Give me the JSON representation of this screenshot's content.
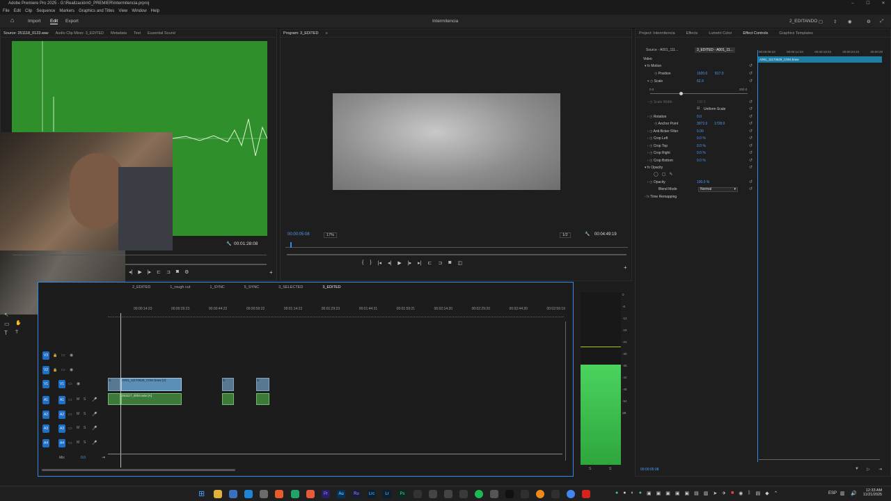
{
  "titlebar": {
    "title": "Adobe Premiere Pro 2025 - G:\\Realización\\0_PREMIER\\Intermitencia.prproj",
    "minimize": "–",
    "maximize": "☐",
    "close": "✕"
  },
  "menu": [
    "File",
    "Edit",
    "Clip",
    "Sequence",
    "Markers",
    "Graphics and Titles",
    "View",
    "Window",
    "Help"
  ],
  "workspace": {
    "home": "⌂",
    "import": "Import",
    "edit": "Edit",
    "export": "Export",
    "project_title": "Intermitencia",
    "workspace_name": "2_EDITANDO"
  },
  "source_panel": {
    "tabs": [
      "Source: 251118_0123.wav",
      "Audio Clip Mixer: 3_EDITED",
      "Metadata",
      "Text",
      "Essential Sound"
    ],
    "timecode": "00:01:28:08"
  },
  "program_panel": {
    "tab": "Program: 3_EDITED",
    "current_time": "00:00:05:08",
    "zoom": "17%",
    "resolution": "1/2",
    "duration": "00:04:49:19"
  },
  "timeline": {
    "sequence_tabs": [
      "2_EDITED",
      "1_rough cut",
      "1_SYNC",
      "5_SYNC",
      "3_SELECTED",
      "3_EDITED"
    ],
    "ruler": [
      "00:00:14:23",
      "00:00:29:23",
      "00:00:44:22",
      "00:00:59:22",
      "00:01:14:22",
      "00:01:29:23",
      "00:01:44:21",
      "00:01:59:21",
      "00:02:14:20",
      "00:02:29:20",
      "00:02:44:20",
      "00:02:59:19"
    ],
    "tracks": [
      {
        "id": "V3",
        "src": ""
      },
      {
        "id": "V2",
        "src": ""
      },
      {
        "id": "V1",
        "src": "V1"
      },
      {
        "id": "A1",
        "src": "A1"
      },
      {
        "id": "A2",
        "src": "A2"
      },
      {
        "id": "A3",
        "src": "A3"
      },
      {
        "id": "A4",
        "src": "A4"
      }
    ],
    "mix_label": "Mix",
    "mix_value": "0.0",
    "clips": {
      "video1": "A001_11170628_C004.braw [V]",
      "audio1": "251117_0004.wav [A]"
    }
  },
  "meter": {
    "scale": [
      "0",
      "-6",
      "-12",
      "-18",
      "-24",
      "-30",
      "-36",
      "-42",
      "-48",
      "-54",
      "dB"
    ],
    "bottom": [
      "S",
      "S"
    ]
  },
  "right_panel": {
    "tabs": [
      "Project: Intermitencia",
      "Effects",
      "Lumetri Color",
      "Effect Controls",
      "Graphics Templates"
    ],
    "source_tab": "Source - A001_111...",
    "seq_tab": "3_EDITED - A001_11...",
    "ruler": [
      "00:00:09:23",
      "00:00:14:23",
      "00:00:19:23",
      "00:00:24:23",
      "00:00:29"
    ],
    "clip_label": "A001_11170628_C004.braw",
    "section_video": "Video",
    "rows": [
      {
        "label": "Motion",
        "value": "",
        "value2": ""
      },
      {
        "label": "Position",
        "value": "1920.0",
        "value2": "817.0"
      },
      {
        "label": "Scale",
        "value": "62.9",
        "value2": ""
      },
      {
        "label": "Scale Width",
        "value": "100.0",
        "value2": ""
      },
      {
        "label": "Rotation",
        "value": "0.0",
        "value2": ""
      },
      {
        "label": "Anchor Point",
        "value": "3072.0",
        "value2": "1728.0"
      },
      {
        "label": "Anti-flicker Filter",
        "value": "0.00",
        "value2": ""
      },
      {
        "label": "Crop Left",
        "value": "0.0 %",
        "value2": ""
      },
      {
        "label": "Crop Top",
        "value": "0.0 %",
        "value2": ""
      },
      {
        "label": "Crop Right",
        "value": "0.0 %",
        "value2": ""
      },
      {
        "label": "Crop Bottom",
        "value": "0.0 %",
        "value2": ""
      },
      {
        "label": "Opacity",
        "value": "",
        "value2": ""
      },
      {
        "label": "Opacity",
        "value": "100.0 %",
        "value2": ""
      },
      {
        "label": "Blend Mode",
        "value": "Normal",
        "value2": ""
      },
      {
        "label": "Time Remapping",
        "value": "",
        "value2": ""
      }
    ],
    "scale_min": "0.0",
    "scale_max": "200.0",
    "uniform_scale": "Uniform Scale",
    "footer_time": "00:00:05:08"
  },
  "taskbar": {
    "time": "12:33 AM",
    "date": "11/21/2025",
    "lang": "ESP"
  },
  "colors": {
    "accent": "#2d8ceb",
    "video_clip": "#5c8fb7",
    "audio_clip": "#3d7a3a",
    "meter": "#35c94a",
    "source_bg": "#2f8f2a"
  }
}
